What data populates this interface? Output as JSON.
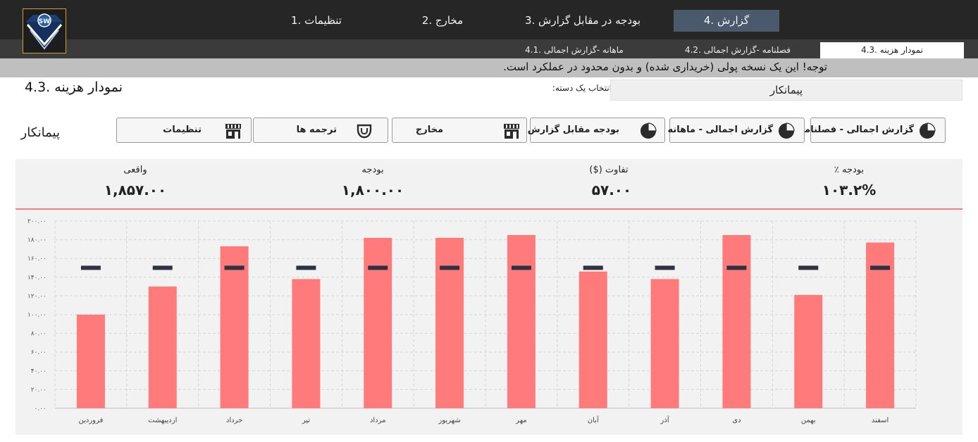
{
  "nav": {
    "items": [
      {
        "label": "تنظیمات .1"
      },
      {
        "label": "مخارج .2"
      },
      {
        "label": "بودجه در مقابل گزارش .3"
      },
      {
        "label": "گزارش .4"
      }
    ],
    "active_index": 3,
    "logo_text": "SW"
  },
  "subnav": {
    "items": [
      {
        "label": "ماهانه -گزارش اجمالی .4.1"
      },
      {
        "label": "فصلنامه -گزارش اجمالی .4.2"
      },
      {
        "label": "نمودار هزینه .4.3"
      }
    ]
  },
  "notice": "توجه! این یک نسخه پولی (خریداری شده) و بدون محدود در عملکرد است.",
  "page": {
    "title": "نمودار هزینه .4.3",
    "select_label": "انتخاب یک دسته:",
    "selected_category": "پیمانکار",
    "category_heading": "پیمانکار"
  },
  "buttons": [
    {
      "label": "گزارش اجمالی - فصلنامه",
      "icon": "pie-chart-icon"
    },
    {
      "label": "گزارش اجمالی - ماهانه",
      "icon": "pie-chart-icon"
    },
    {
      "label": "بودجه مقابل گزارش",
      "icon": "pie-chart-icon"
    },
    {
      "label": "مخارج",
      "icon": "store-icon"
    },
    {
      "label": "ترجمه ها",
      "icon": "translate-icon"
    },
    {
      "label": "تنظیمات",
      "icon": "store-icon"
    }
  ],
  "kpis": {
    "actual_title": "واقعی",
    "actual_value": "۱,۸۵۷.۰۰",
    "budget_title": "بودجه",
    "budget_value": "۱,۸۰۰.۰۰",
    "diff_title": "تفاوت ($)",
    "diff_value": "۵۷.۰۰",
    "budget_pct_title": "بودجه ٪",
    "budget_pct_value": "۱۰۳.۲%"
  },
  "colors": {
    "bar": "#ff7b7b",
    "budget_marker": "#2d3342",
    "kpi_line": "#f08080",
    "active_tab": "#4a5a6c"
  },
  "chart_data": {
    "type": "bar",
    "categories": [
      "فروردین",
      "اردیبهشت",
      "خرداد",
      "تیر",
      "مرداد",
      "شهریور",
      "مهر",
      "آبان",
      "آذر",
      "دی",
      "بهمن",
      "اسفند"
    ],
    "series": [
      {
        "values": [
          100,
          130,
          173,
          138,
          182,
          182,
          185,
          146,
          138,
          185,
          121,
          177
        ]
      },
      {
        "values": [
          150,
          150,
          150,
          150,
          150,
          150,
          150,
          150,
          150,
          150,
          150,
          150
        ]
      }
    ],
    "ylim": [
      0,
      200
    ],
    "yticks": [
      0,
      20,
      40,
      60,
      80,
      100,
      120,
      140,
      160,
      180,
      200
    ],
    "ytick_labels": [
      "۰.۰۰",
      "۲۰.۰۰",
      "۴۰.۰۰",
      "۶۰.۰۰",
      "۸۰.۰۰",
      "۱۰۰.۰۰",
      "۱۲۰.۰۰",
      "۱۴۰.۰۰",
      "۱۶۰.۰۰",
      "۱۸۰.۰۰",
      "۲۰۰.۰۰"
    ],
    "grid": true,
    "title": "",
    "xlabel": "",
    "ylabel": ""
  }
}
